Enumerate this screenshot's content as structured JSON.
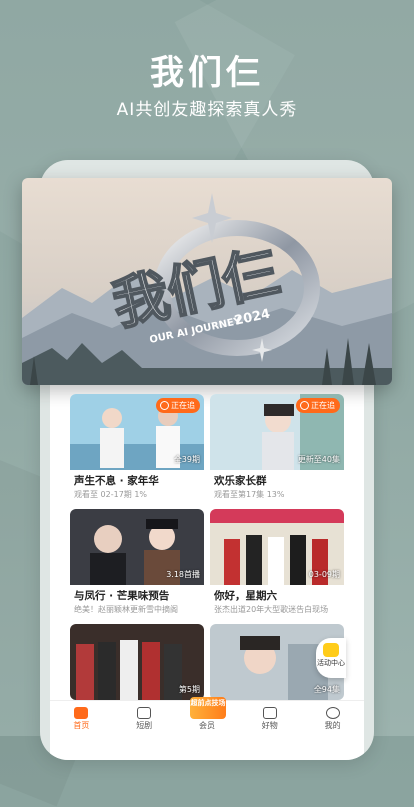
{
  "hero": {
    "title": "我们仨",
    "subtitle": "AI共创友趣探索真人秀"
  },
  "banner": {
    "logo_text": "我们仨",
    "logo_sub": "OUR AI JOURNEY",
    "logo_year": "2024"
  },
  "cards": [
    {
      "title": "声生不息 · 家年华",
      "meta": "观看至 02-17期 1%",
      "badge": "正在追",
      "episode": "全39期"
    },
    {
      "title": "欢乐家长群",
      "meta": "观看至第17集 13%",
      "badge": "正在追",
      "episode": "更新至40集"
    },
    {
      "title": "与凤行 · 芒果味预告",
      "meta": "绝美！赵丽颖林更新雪中摘阁",
      "badge": "",
      "episode": "3.18首播"
    },
    {
      "title": "你好，星期六",
      "meta": "张杰出道20年大型歌迷告白现场",
      "badge": "",
      "episode": "03-09期"
    },
    {
      "title": "",
      "meta": "",
      "badge": "",
      "episode": "第5期"
    },
    {
      "title": "",
      "meta": "",
      "badge": "",
      "episode": "全94集"
    }
  ],
  "activity_center": "活动中心",
  "vip_pill": "超前点技场",
  "tabs": [
    {
      "label": "首页",
      "icon": "home-icon"
    },
    {
      "label": "短剧",
      "icon": "short-drama-icon"
    },
    {
      "label": "会员",
      "icon": "vip-icon"
    },
    {
      "label": "好物",
      "icon": "cart-icon"
    },
    {
      "label": "我的",
      "icon": "profile-icon"
    }
  ],
  "colors": {
    "accent": "#ff6a1a",
    "background": "#8aa39e"
  }
}
